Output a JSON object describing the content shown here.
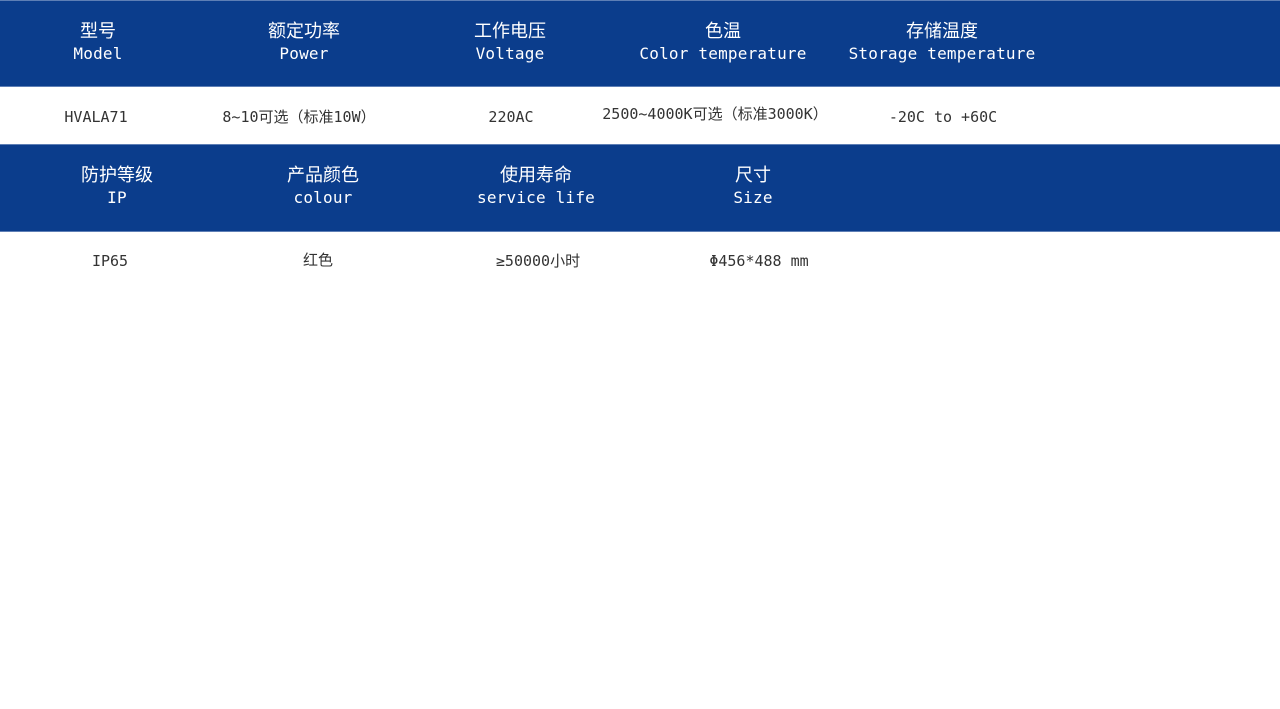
{
  "section1": {
    "headers": [
      {
        "zh": "型号",
        "en": "Model"
      },
      {
        "zh": "额定功率",
        "en": "Power"
      },
      {
        "zh": "工作电压",
        "en": "Voltage"
      },
      {
        "zh": "色温",
        "en": "Color temperature"
      },
      {
        "zh": "存储温度",
        "en": "Storage temperature"
      }
    ],
    "values": [
      "HVALA71",
      "8~10可选（标准10W）",
      "220AC",
      "2500~4000K可选（标准3000K）",
      "-20C to +60C"
    ]
  },
  "section2": {
    "headers": [
      {
        "zh": "防护等级",
        "en": "IP"
      },
      {
        "zh": "产品颜色",
        "en": "colour"
      },
      {
        "zh": "使用寿命",
        "en": "service life"
      },
      {
        "zh": "尺寸",
        "en": "Size"
      }
    ],
    "values": [
      "IP65",
      "红色",
      "≥50000小时",
      "Φ456*488 mm"
    ]
  },
  "colors": {
    "header_background": "#0b3d8c",
    "header_text": "#ffffff",
    "value_text": "#333333"
  }
}
